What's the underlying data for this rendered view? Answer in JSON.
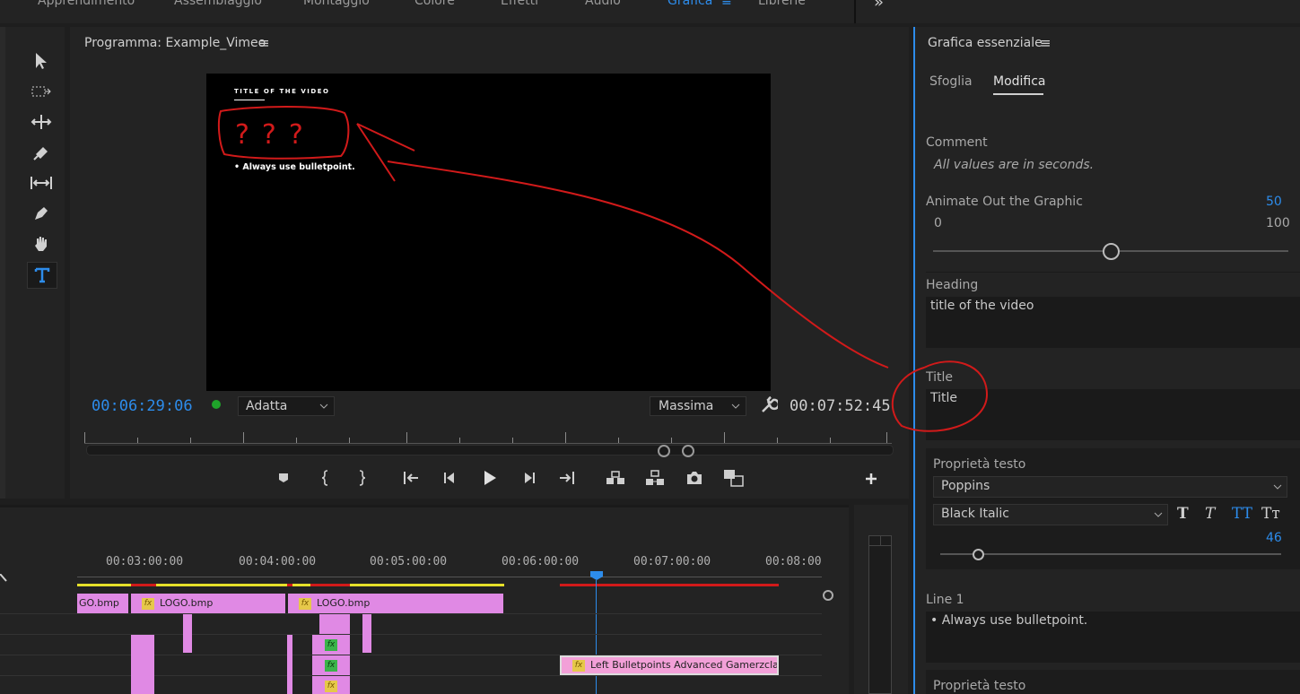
{
  "workspaces": [
    {
      "label": "Apprendimento",
      "active": false
    },
    {
      "label": "Assemblaggio",
      "active": false
    },
    {
      "label": "Montaggio",
      "active": false
    },
    {
      "label": "Colore",
      "active": false
    },
    {
      "label": "Effetti",
      "active": false
    },
    {
      "label": "Audio",
      "active": false
    },
    {
      "label": "Grafica",
      "active": true
    },
    {
      "label": "Librerie",
      "active": false
    }
  ],
  "workspace_more": "»",
  "monitor": {
    "title": "Programma: Example_Vimeo",
    "video_heading": "TITLE OF THE VIDEO",
    "video_bullet": "• Always use bulletpoint.",
    "annotation_text": "???",
    "timecode_current": "00:06:29:06",
    "fit": "Adatta",
    "quality": "Massima",
    "timecode_duration": "00:07:52:45"
  },
  "transport_icons": [
    "marker-icon",
    "mark-in-icon",
    "mark-out-icon",
    "go-to-in-icon",
    "step-back-icon",
    "play-icon",
    "step-forward-icon",
    "go-to-out-icon",
    "lift-icon",
    "extract-icon",
    "export-frame-icon",
    "compare-icon",
    "add-button-icon"
  ],
  "timeline": {
    "ruler": [
      "00:03:00:00",
      "00:04:00:00",
      "00:05:00:00",
      "00:06:00:00",
      "00:07:00:00",
      "00:08:00:0"
    ],
    "clips": {
      "logo_partial": "GO.bmp",
      "logo_1": "LOGO.bmp",
      "logo_2": "LOGO.bmp",
      "graphic": "Left Bulletpoints Advanced Gamerzclas"
    },
    "fx_label": "fx"
  },
  "essential_graphics": {
    "title": "Grafica essenziale",
    "tabs": [
      {
        "label": "Sfoglia",
        "active": false
      },
      {
        "label": "Modifica",
        "active": true
      }
    ],
    "comment_label": "Comment",
    "comment_text": "All values are in seconds.",
    "animate_label": "Animate Out the Graphic",
    "animate_value": "50",
    "animate_min": "0",
    "animate_max": "100",
    "animate_fraction": 0.5,
    "heading_label": "Heading",
    "heading_value": "title of the video",
    "title_label": "Title",
    "title_value": "Title",
    "text_props_label": "Proprietà testo",
    "font": "Poppins",
    "font_style": "Black Italic",
    "font_size": "46",
    "line1_label": "Line 1",
    "line1_value": "• Always use bulletpoint.",
    "text_props_label_2": "Proprietà testo",
    "style_buttons": [
      "T",
      "T",
      "TT",
      "Tт"
    ]
  },
  "colors": {
    "accent": "#2d8ceb",
    "annotation": "#d11a1a",
    "clip_pink": "#e089e4"
  }
}
